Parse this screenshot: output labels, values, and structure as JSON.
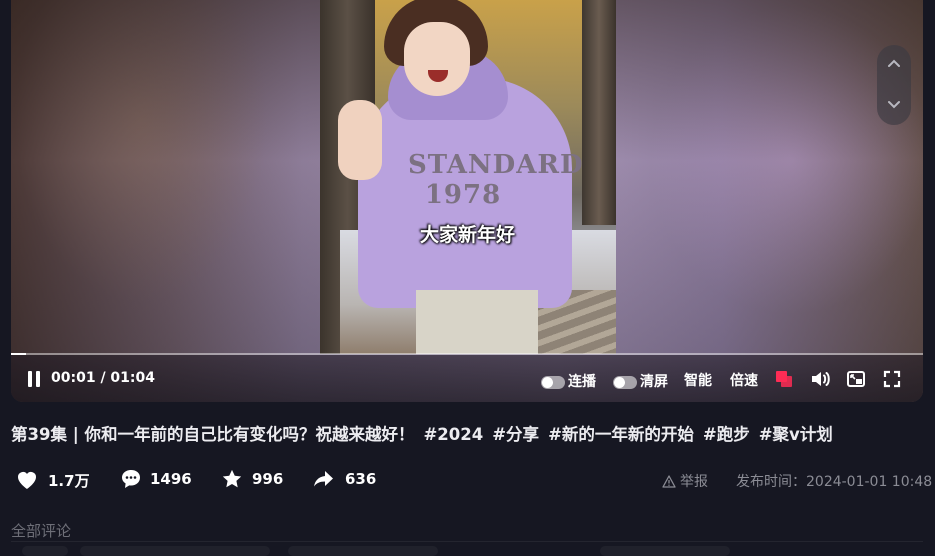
{
  "player": {
    "subtitle": "大家新年好",
    "time": "00:01 / 01:04",
    "progress_fraction": 0.016,
    "controls": {
      "autoplay_label": "连播",
      "clear_screen_label": "清屏",
      "smart_label": "智能",
      "speed_label": "倍速"
    },
    "shirt_print": "STANDARD 1978"
  },
  "video": {
    "title": "第39集 | 你和一年前的自己比有变化吗？祝越来越好！",
    "tags": [
      "#2024",
      "#分享",
      "#新的一年新的开始",
      "#跑步",
      "#聚v计划"
    ]
  },
  "actions": {
    "likes": "1.7万",
    "comments": "1496",
    "favorites": "996",
    "shares": "636",
    "report_label": "举报",
    "publish_time": "发布时间：2024-01-01 10:48"
  },
  "comments": {
    "section_title": "全部评论"
  },
  "colors": {
    "background": "#161722",
    "danmu_accent": "#fe2c55"
  }
}
